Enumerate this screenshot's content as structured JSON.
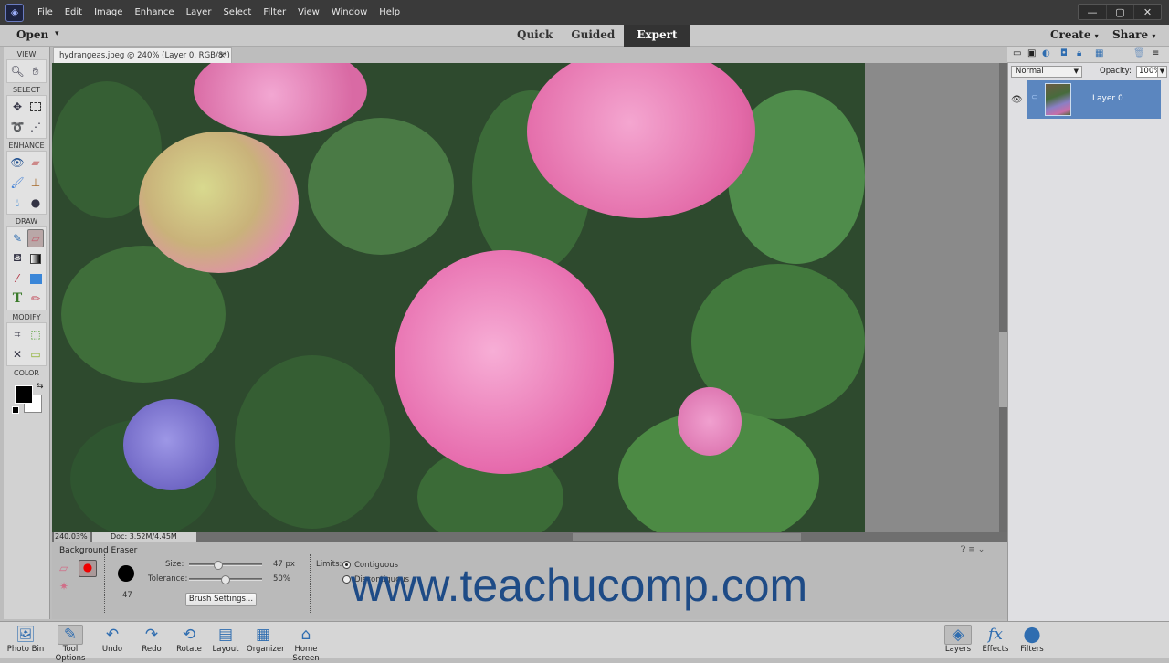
{
  "window": {
    "menu": [
      "File",
      "Edit",
      "Image",
      "Enhance",
      "Layer",
      "Select",
      "Filter",
      "View",
      "Window",
      "Help"
    ],
    "controls": {
      "minimize": "—",
      "maximize": "▢",
      "close": "✕"
    }
  },
  "topbar": {
    "open_label": "Open",
    "modes": [
      {
        "label": "Quick",
        "active": false
      },
      {
        "label": "Guided",
        "active": false
      },
      {
        "label": "Expert",
        "active": true
      }
    ],
    "create_label": "Create",
    "share_label": "Share"
  },
  "document": {
    "tab_title": "hydrangeas.jpeg @ 240% (Layer 0, RGB/8*) *",
    "close_glyph": "×",
    "zoom_level": "240.03%",
    "doc_size": "Doc: 3.52M/4.45M",
    "image_description": "Photo of pink, lime and purple hydrangea blooms among green leaves"
  },
  "toolbox": {
    "sections": [
      {
        "title": "VIEW",
        "tools": [
          "zoom",
          "hand"
        ]
      },
      {
        "title": "SELECT",
        "tools": [
          "move",
          "rectangular-marquee",
          "lasso",
          "quick-selection"
        ]
      },
      {
        "title": "ENHANCE",
        "tools": [
          "red-eye",
          "spot-healing",
          "smart-brush",
          "clone-stamp",
          "blur",
          "sponge"
        ]
      },
      {
        "title": "DRAW",
        "tools": [
          "brush",
          "eraser",
          "paint-bucket",
          "gradient",
          "eyedropper",
          "shape",
          "type",
          "pencil"
        ]
      },
      {
        "title": "MODIFY",
        "tools": [
          "crop",
          "recompose",
          "content-aware-move",
          "straighten"
        ]
      },
      {
        "title": "COLOR",
        "tools": []
      }
    ],
    "active_tool": "eraser",
    "foreground_color": "#000000",
    "background_color": "#ffffff"
  },
  "tool_options": {
    "title": "Background Eraser",
    "brush_preview_size": "47",
    "size_label": "Size:",
    "size_value": "47 px",
    "size_slider_fraction": 0.4,
    "tolerance_label": "Tolerance:",
    "tolerance_value": "50%",
    "tolerance_slider_fraction": 0.5,
    "brush_settings_label": "Brush Settings...",
    "limits_label": "Limits:",
    "limits_options": [
      {
        "label": "Contiguous",
        "selected": true
      },
      {
        "label": "Discontiguous",
        "selected": false
      }
    ]
  },
  "layers_panel": {
    "blend_mode": "Normal",
    "opacity_label": "Opacity:",
    "opacity_value": "100%",
    "layers": [
      {
        "name": "Layer 0",
        "visible": true,
        "selected": true
      }
    ]
  },
  "bottombar": {
    "left": [
      {
        "label": "Photo Bin",
        "icon": "photo-bin-icon",
        "glyph": "🖼"
      },
      {
        "label": "Tool Options",
        "icon": "tool-options-icon",
        "glyph": "✎",
        "active": true
      },
      {
        "label": "Undo",
        "icon": "undo-icon",
        "glyph": "↶"
      },
      {
        "label": "Redo",
        "icon": "redo-icon",
        "glyph": "↷"
      },
      {
        "label": "Rotate",
        "icon": "rotate-icon",
        "glyph": "⟲"
      },
      {
        "label": "Layout",
        "icon": "layout-icon",
        "glyph": "▤"
      },
      {
        "label": "Organizer",
        "icon": "organizer-icon",
        "glyph": "▦"
      },
      {
        "label": "Home Screen",
        "icon": "home-icon",
        "glyph": "⌂"
      }
    ],
    "right": [
      {
        "label": "Layers",
        "icon": "layers-icon",
        "glyph": "◈",
        "active": true
      },
      {
        "label": "Effects",
        "icon": "effects-icon",
        "glyph": "fx"
      },
      {
        "label": "Filters",
        "icon": "filters-icon",
        "glyph": "⬤"
      }
    ]
  },
  "watermark": "www.teachucomp.com",
  "colors": {
    "accent_layer_selected": "#5b86bf",
    "watermark": "#1e4b86"
  }
}
